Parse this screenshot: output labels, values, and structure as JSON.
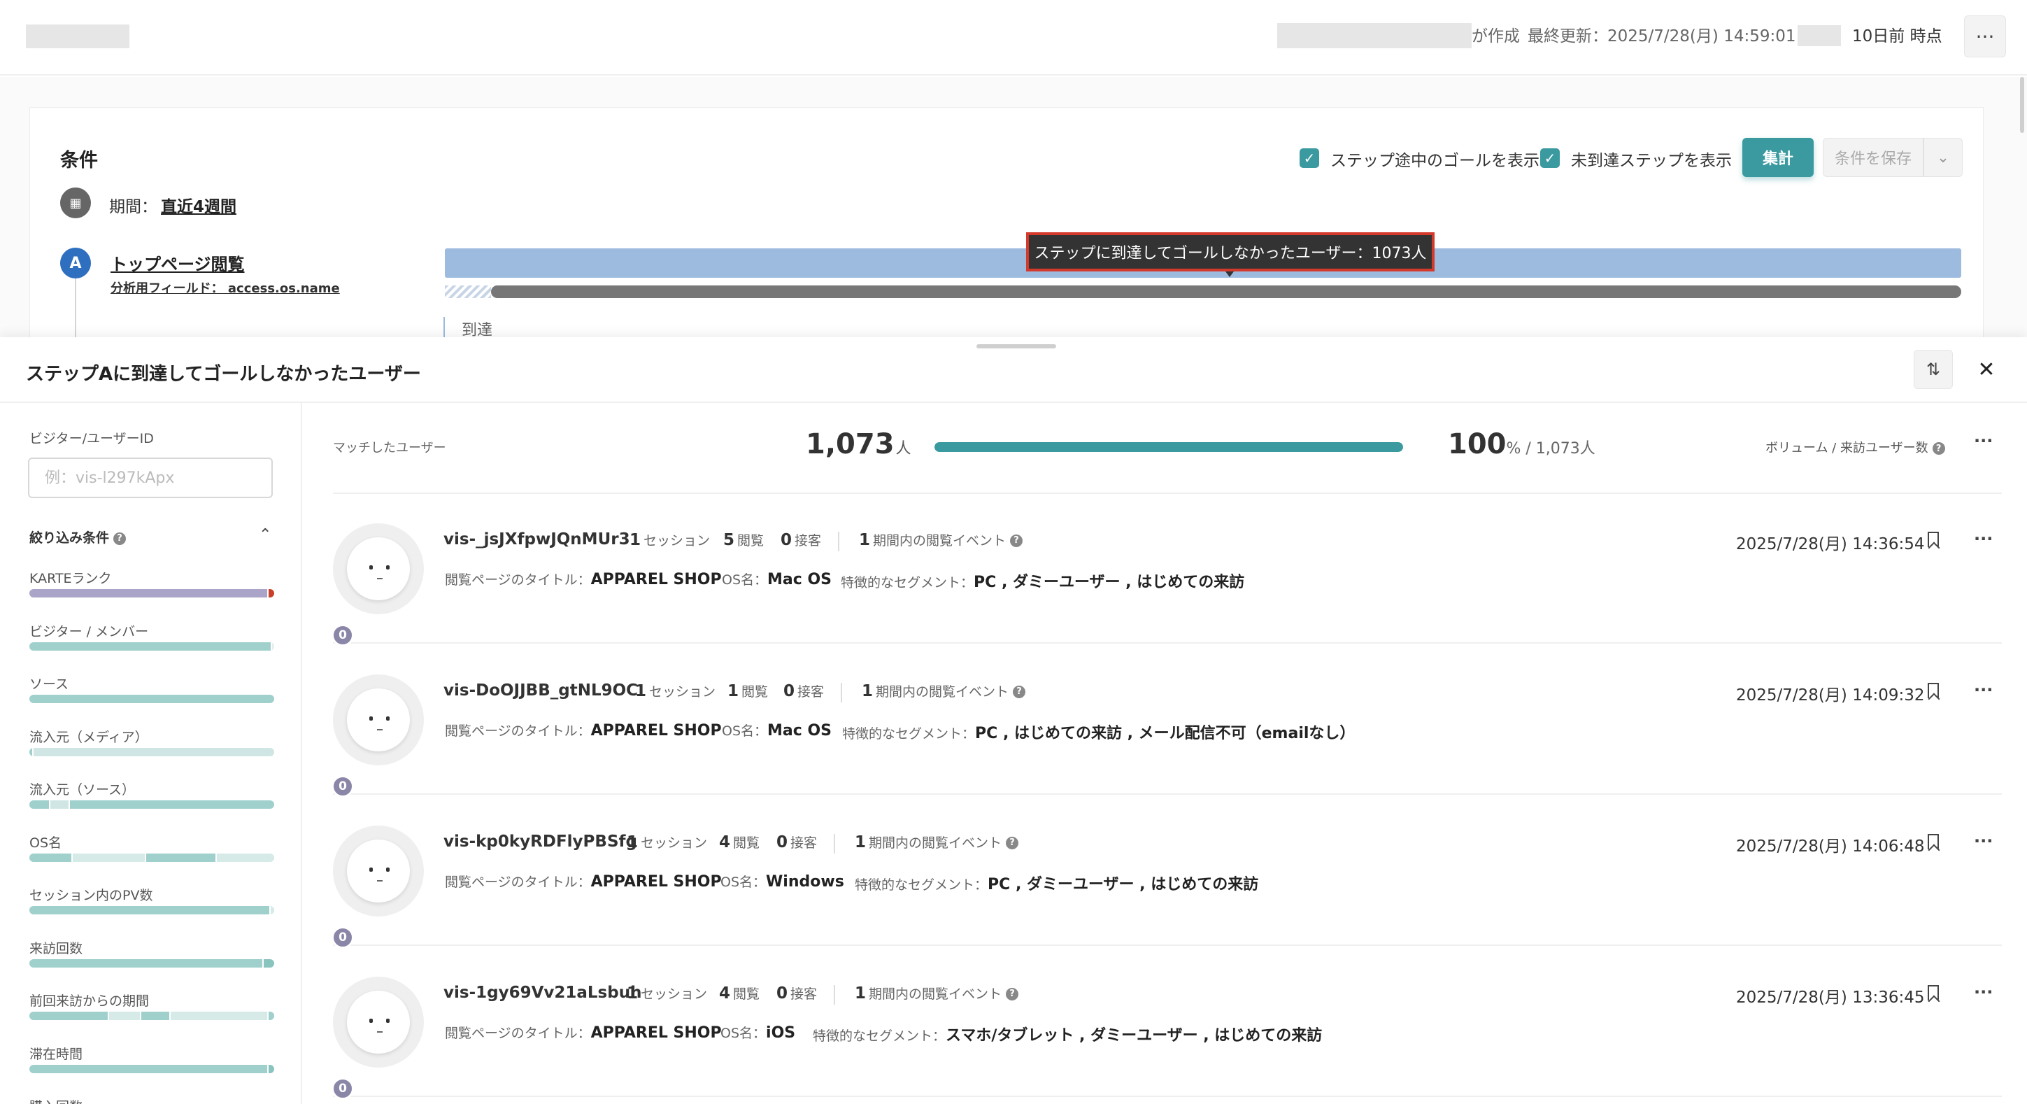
{
  "header": {
    "created_by_suffix": "が作成",
    "last_updated_label": "最終更新：",
    "last_updated_value": "2025/7/28(月) 14:59:01 by",
    "snapshot_label": "10日前 時点",
    "more_label": "···"
  },
  "conditions": {
    "title": "条件",
    "show_goals_label": "ステップ途中のゴールを表示",
    "show_unreached_label": "未到達ステップを表示",
    "check_mark": "✓",
    "aggregate_button": "集計",
    "save_button": "条件を保存",
    "save_caret": "⌄",
    "period_icon": "▦",
    "period_label": "期間：",
    "period_value": "直近4週間",
    "step": {
      "badge": "A",
      "name": "トップページ閲覧",
      "field": "分析用フィールド： access.os.name",
      "reach_label": "到達"
    },
    "tooltip": "ステップに到達してゴールしなかったユーザー：1073人"
  },
  "drawer": {
    "title": "ステップAに到達してゴールしなかったユーザー",
    "sort_icon": "⇅",
    "close_icon": "✕",
    "filter": {
      "id_label": "ビジター/ユーザーID",
      "id_placeholder": "例：vis-l297kApx",
      "head_label": "絞り込み条件",
      "help": "?",
      "collapse_icon": "⌃",
      "items": [
        {
          "label": "KARTEランク",
          "segments": [
            {
              "w": 0.97,
              "c": "#a9a4c8"
            },
            {
              "w": 0.03,
              "c": "#c9402a"
            }
          ]
        },
        {
          "label": "ビジター / メンバー",
          "segments": [
            {
              "w": 0.985,
              "c": "#9fd0cc"
            },
            {
              "w": 0.015,
              "c": "#e4efee"
            }
          ]
        },
        {
          "label": "ソース",
          "segments": [
            {
              "w": 1.0,
              "c": "#9fd0cc"
            }
          ]
        },
        {
          "label": "流入元（メディア）",
          "segments": [
            {
              "w": 0.01,
              "c": "#9fd0cc"
            },
            {
              "w": 0.99,
              "c": "#cfe6e4"
            }
          ]
        },
        {
          "label": "流入元（ソース）",
          "segments": [
            {
              "w": 0.08,
              "c": "#9fd0cc"
            },
            {
              "w": 0.08,
              "c": "#cfe6e4"
            },
            {
              "w": 0.84,
              "c": "#9fd0cc"
            }
          ]
        },
        {
          "label": "OS名",
          "segments": [
            {
              "w": 0.17,
              "c": "#9fd0cc"
            },
            {
              "w": 0.3,
              "c": "#d6eae8"
            },
            {
              "w": 0.29,
              "c": "#9fd0cc"
            },
            {
              "w": 0.24,
              "c": "#d6eae8"
            }
          ]
        },
        {
          "label": "セッション内のPV数",
          "segments": [
            {
              "w": 0.98,
              "c": "#9fd0cc"
            },
            {
              "w": 0.02,
              "c": "#d6eae8"
            }
          ]
        },
        {
          "label": "来訪回数",
          "segments": [
            {
              "w": 0.95,
              "c": "#9fd0cc"
            },
            {
              "w": 0.05,
              "c": "#8ac4bf"
            }
          ]
        },
        {
          "label": "前回来訪からの期間",
          "segments": [
            {
              "w": 0.32,
              "c": "#9fd0cc"
            },
            {
              "w": 0.13,
              "c": "#d6eae8"
            },
            {
              "w": 0.12,
              "c": "#9fd0cc"
            },
            {
              "w": 0.4,
              "c": "#d6eae8"
            },
            {
              "w": 0.03,
              "c": "#9fd0cc"
            }
          ]
        },
        {
          "label": "滞在時間",
          "segments": [
            {
              "w": 0.97,
              "c": "#9fd0cc"
            },
            {
              "w": 0.03,
              "c": "#8ac4bf"
            }
          ]
        },
        {
          "label": "購入回数",
          "segments": [
            {
              "w": 1.0,
              "c": "#9fd0cc"
            }
          ]
        }
      ]
    },
    "summary": {
      "matched_label": "マッチしたユーザー",
      "count": "1,073",
      "count_unit": "人",
      "fill_fraction": 1.0,
      "percent": "100",
      "percent_rest": "% / 1,073人",
      "ratio_label": "ボリューム / 来訪ユーザー数",
      "help": "?",
      "more": "···"
    },
    "labels": {
      "sessions": "セッション",
      "views": "閲覧",
      "contacts": "接客",
      "events": "期間内の閲覧イベント",
      "page_title": "閲覧ページのタイトル：",
      "os_name": "OS名：",
      "segment": "特徴的なセグメント：",
      "help": "?",
      "more": "···"
    },
    "users": [
      {
        "id": "vis-_jsJXfpwJQnMUr3",
        "sessions": "1",
        "views": "5",
        "contacts": "0",
        "events": "1",
        "page_title": "APPAREL SHOP",
        "os": "Mac OS",
        "segments": "PC , ダミーユーザー , はじめての来訪",
        "timestamp": "2025/7/28(月) 14:36:54",
        "badge": "0"
      },
      {
        "id": "vis-DoOJJBB_gtNL9OC",
        "sessions": "1",
        "views": "1",
        "contacts": "0",
        "events": "1",
        "page_title": "APPAREL SHOP",
        "os": "Mac OS",
        "segments": "PC , はじめての来訪 , メール配信不可（emailなし）",
        "timestamp": "2025/7/28(月) 14:09:32",
        "badge": "0"
      },
      {
        "id": "vis-kp0kyRDFlyPBSfg",
        "sessions": "1",
        "views": "4",
        "contacts": "0",
        "events": "1",
        "page_title": "APPAREL SHOP",
        "os": "Windows",
        "segments": "PC , ダミーユーザー , はじめての来訪",
        "timestamp": "2025/7/28(月) 14:06:48",
        "badge": "0"
      },
      {
        "id": "vis-1gy69Vv21aLsbuh",
        "sessions": "1",
        "views": "4",
        "contacts": "0",
        "events": "1",
        "page_title": "APPAREL SHOP",
        "os": "iOS",
        "segments": "スマホ/タブレット , ダミーユーザー , はじめての来訪",
        "timestamp": "2025/7/28(月) 13:36:45",
        "badge": "0"
      }
    ]
  }
}
